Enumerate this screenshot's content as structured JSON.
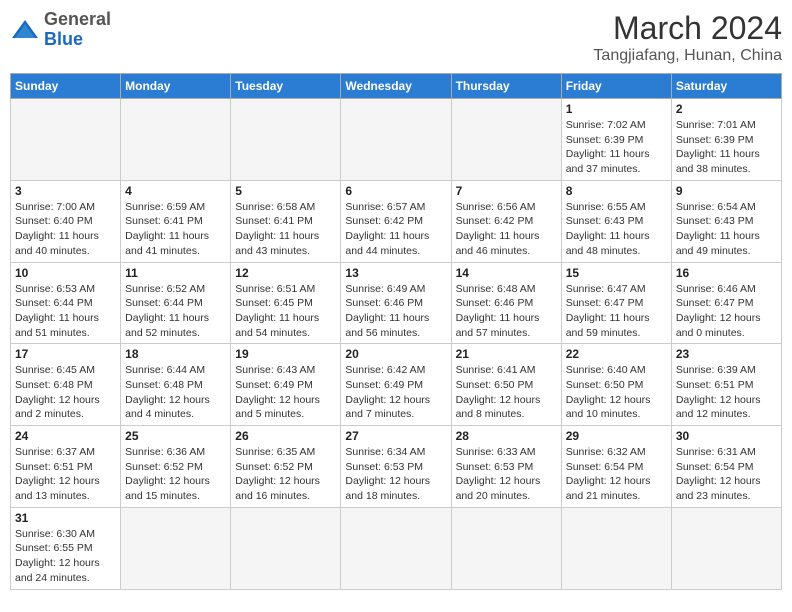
{
  "header": {
    "logo_general": "General",
    "logo_blue": "Blue",
    "month_year": "March 2024",
    "location": "Tangjiafang, Hunan, China"
  },
  "weekdays": [
    "Sunday",
    "Monday",
    "Tuesday",
    "Wednesday",
    "Thursday",
    "Friday",
    "Saturday"
  ],
  "weeks": [
    [
      {
        "day": "",
        "info": ""
      },
      {
        "day": "",
        "info": ""
      },
      {
        "day": "",
        "info": ""
      },
      {
        "day": "",
        "info": ""
      },
      {
        "day": "",
        "info": ""
      },
      {
        "day": "1",
        "info": "Sunrise: 7:02 AM\nSunset: 6:39 PM\nDaylight: 11 hours\nand 37 minutes."
      },
      {
        "day": "2",
        "info": "Sunrise: 7:01 AM\nSunset: 6:39 PM\nDaylight: 11 hours\nand 38 minutes."
      }
    ],
    [
      {
        "day": "3",
        "info": "Sunrise: 7:00 AM\nSunset: 6:40 PM\nDaylight: 11 hours\nand 40 minutes."
      },
      {
        "day": "4",
        "info": "Sunrise: 6:59 AM\nSunset: 6:41 PM\nDaylight: 11 hours\nand 41 minutes."
      },
      {
        "day": "5",
        "info": "Sunrise: 6:58 AM\nSunset: 6:41 PM\nDaylight: 11 hours\nand 43 minutes."
      },
      {
        "day": "6",
        "info": "Sunrise: 6:57 AM\nSunset: 6:42 PM\nDaylight: 11 hours\nand 44 minutes."
      },
      {
        "day": "7",
        "info": "Sunrise: 6:56 AM\nSunset: 6:42 PM\nDaylight: 11 hours\nand 46 minutes."
      },
      {
        "day": "8",
        "info": "Sunrise: 6:55 AM\nSunset: 6:43 PM\nDaylight: 11 hours\nand 48 minutes."
      },
      {
        "day": "9",
        "info": "Sunrise: 6:54 AM\nSunset: 6:43 PM\nDaylight: 11 hours\nand 49 minutes."
      }
    ],
    [
      {
        "day": "10",
        "info": "Sunrise: 6:53 AM\nSunset: 6:44 PM\nDaylight: 11 hours\nand 51 minutes."
      },
      {
        "day": "11",
        "info": "Sunrise: 6:52 AM\nSunset: 6:44 PM\nDaylight: 11 hours\nand 52 minutes."
      },
      {
        "day": "12",
        "info": "Sunrise: 6:51 AM\nSunset: 6:45 PM\nDaylight: 11 hours\nand 54 minutes."
      },
      {
        "day": "13",
        "info": "Sunrise: 6:49 AM\nSunset: 6:46 PM\nDaylight: 11 hours\nand 56 minutes."
      },
      {
        "day": "14",
        "info": "Sunrise: 6:48 AM\nSunset: 6:46 PM\nDaylight: 11 hours\nand 57 minutes."
      },
      {
        "day": "15",
        "info": "Sunrise: 6:47 AM\nSunset: 6:47 PM\nDaylight: 11 hours\nand 59 minutes."
      },
      {
        "day": "16",
        "info": "Sunrise: 6:46 AM\nSunset: 6:47 PM\nDaylight: 12 hours\nand 0 minutes."
      }
    ],
    [
      {
        "day": "17",
        "info": "Sunrise: 6:45 AM\nSunset: 6:48 PM\nDaylight: 12 hours\nand 2 minutes."
      },
      {
        "day": "18",
        "info": "Sunrise: 6:44 AM\nSunset: 6:48 PM\nDaylight: 12 hours\nand 4 minutes."
      },
      {
        "day": "19",
        "info": "Sunrise: 6:43 AM\nSunset: 6:49 PM\nDaylight: 12 hours\nand 5 minutes."
      },
      {
        "day": "20",
        "info": "Sunrise: 6:42 AM\nSunset: 6:49 PM\nDaylight: 12 hours\nand 7 minutes."
      },
      {
        "day": "21",
        "info": "Sunrise: 6:41 AM\nSunset: 6:50 PM\nDaylight: 12 hours\nand 8 minutes."
      },
      {
        "day": "22",
        "info": "Sunrise: 6:40 AM\nSunset: 6:50 PM\nDaylight: 12 hours\nand 10 minutes."
      },
      {
        "day": "23",
        "info": "Sunrise: 6:39 AM\nSunset: 6:51 PM\nDaylight: 12 hours\nand 12 minutes."
      }
    ],
    [
      {
        "day": "24",
        "info": "Sunrise: 6:37 AM\nSunset: 6:51 PM\nDaylight: 12 hours\nand 13 minutes."
      },
      {
        "day": "25",
        "info": "Sunrise: 6:36 AM\nSunset: 6:52 PM\nDaylight: 12 hours\nand 15 minutes."
      },
      {
        "day": "26",
        "info": "Sunrise: 6:35 AM\nSunset: 6:52 PM\nDaylight: 12 hours\nand 16 minutes."
      },
      {
        "day": "27",
        "info": "Sunrise: 6:34 AM\nSunset: 6:53 PM\nDaylight: 12 hours\nand 18 minutes."
      },
      {
        "day": "28",
        "info": "Sunrise: 6:33 AM\nSunset: 6:53 PM\nDaylight: 12 hours\nand 20 minutes."
      },
      {
        "day": "29",
        "info": "Sunrise: 6:32 AM\nSunset: 6:54 PM\nDaylight: 12 hours\nand 21 minutes."
      },
      {
        "day": "30",
        "info": "Sunrise: 6:31 AM\nSunset: 6:54 PM\nDaylight: 12 hours\nand 23 minutes."
      }
    ],
    [
      {
        "day": "31",
        "info": "Sunrise: 6:30 AM\nSunset: 6:55 PM\nDaylight: 12 hours\nand 24 minutes."
      },
      {
        "day": "",
        "info": ""
      },
      {
        "day": "",
        "info": ""
      },
      {
        "day": "",
        "info": ""
      },
      {
        "day": "",
        "info": ""
      },
      {
        "day": "",
        "info": ""
      },
      {
        "day": "",
        "info": ""
      }
    ]
  ]
}
